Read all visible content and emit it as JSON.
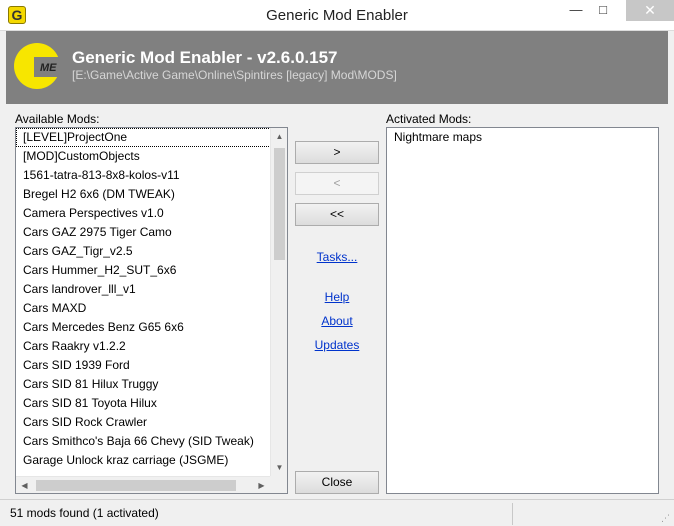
{
  "window": {
    "title": "Generic Mod Enabler",
    "minimize_glyph": "—",
    "maximize_glyph": "□",
    "close_glyph": "✕",
    "icon_letter": "G"
  },
  "header": {
    "logo_text": "ME",
    "title": "Generic Mod Enabler - v2.6.0.157",
    "path": "[E:\\Game\\Active Game\\Online\\Spintires [legacy] Mod\\MODS]"
  },
  "available": {
    "label": "Available Mods:",
    "items": [
      "[LEVEL]ProjectOne",
      "[MOD]CustomObjects",
      "1561-tatra-813-8x8-kolos-v11",
      "Bregel H2 6x6 (DM TWEAK)",
      "Camera Perspectives v1.0",
      "Cars GAZ 2975 Tiger Camo",
      "Cars GAZ_Tigr_v2.5",
      "Cars Hummer_H2_SUT_6x6",
      "Cars landrover_lll_v1",
      "Cars MAXD",
      "Cars Mercedes Benz G65 6x6",
      "Cars Raakry v1.2.2",
      "Cars SID 1939 Ford",
      "Cars SID 81 Hilux Truggy",
      "Cars SID 81 Toyota Hilux",
      "Cars SID Rock Crawler",
      "Cars Smithco's Baja 66 Chevy (SID Tweak)",
      "Garage Unlock kraz carriage (JSGME)"
    ]
  },
  "activated": {
    "label": "Activated Mods:",
    "items": [
      "Nightmare maps"
    ]
  },
  "buttons": {
    "activate": ">",
    "deactivate": "<",
    "deactivate_all": "<<",
    "close": "Close"
  },
  "links": {
    "tasks": "Tasks...",
    "help": "Help",
    "about": "About",
    "updates": "Updates"
  },
  "scroll": {
    "up": "▲",
    "down": "▼",
    "left": "◀",
    "right": "▶"
  },
  "status": {
    "text": "51 mods found (1 activated)"
  },
  "colors": {
    "header_bg": "#808080",
    "logo_yellow": "#f7e600",
    "link": "#0033cc"
  }
}
